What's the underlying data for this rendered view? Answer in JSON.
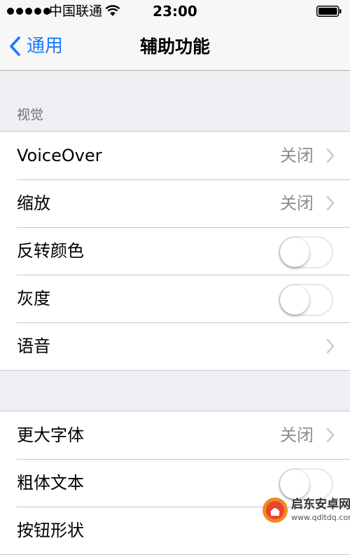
{
  "status_bar": {
    "carrier": "中国联通",
    "time": "23:00"
  },
  "nav": {
    "back_label": "通用",
    "title": "辅助功能"
  },
  "sections": {
    "vision_header": "视觉"
  },
  "group1": {
    "voiceover": {
      "label": "VoiceOver",
      "value": "关闭"
    },
    "zoom": {
      "label": "缩放",
      "value": "关闭"
    },
    "invert_colors": {
      "label": "反转颜色",
      "on": false
    },
    "grayscale": {
      "label": "灰度",
      "on": false
    },
    "speech": {
      "label": "语音"
    }
  },
  "group2": {
    "larger_text": {
      "label": "更大字体",
      "value": "关闭"
    },
    "bold_text": {
      "label": "粗体文本",
      "on": false
    },
    "button_shapes": {
      "label": "按钮形状"
    }
  },
  "watermark": {
    "title": "启东安卓网",
    "url": "www.qdltdq.com"
  },
  "colors": {
    "accent": "#1a7cf9",
    "background": "#efeff4",
    "secondary_text": "#8e8e93",
    "separator": "#c8c7cc"
  },
  "icons": [
    "signal-dots-icon",
    "wifi-icon",
    "battery-icon",
    "back-chevron-icon",
    "chevron-right-icon",
    "watermark-logo-icon"
  ]
}
